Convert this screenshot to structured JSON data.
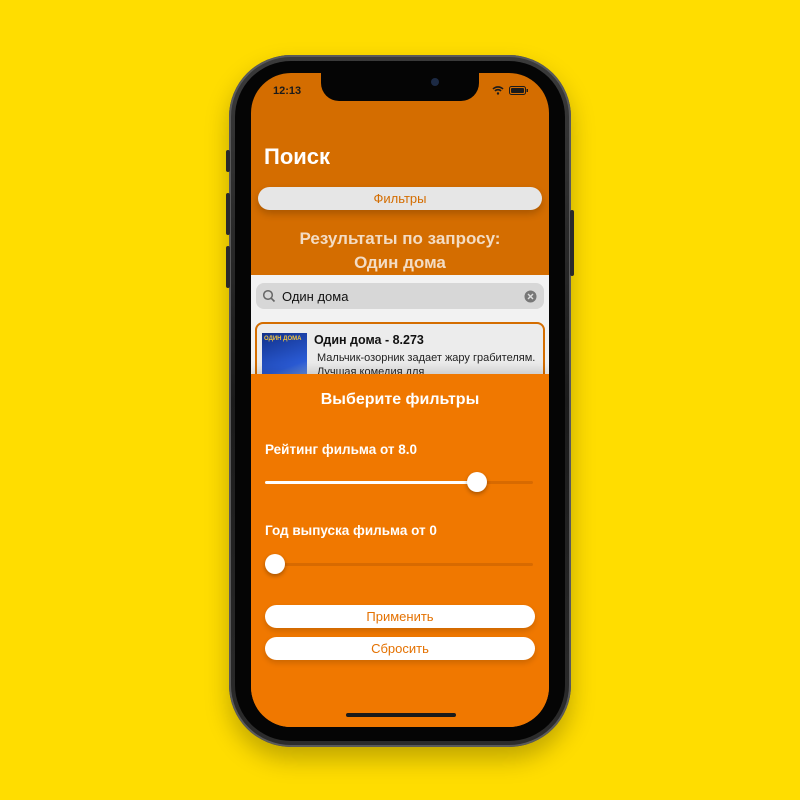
{
  "status_bar": {
    "time": "12:13",
    "wifi_icon": "wifi-icon",
    "battery_icon": "battery-icon"
  },
  "header": {
    "title": "Поиск"
  },
  "filters_button": {
    "label": "Фильтры"
  },
  "results": {
    "line1": "Результаты по запросу:",
    "line2": "Один дома"
  },
  "search": {
    "value": "Один дома",
    "search_icon": "magnifier-icon",
    "clear_icon": "clear-icon"
  },
  "movie": {
    "title": "Один дома - 8.273",
    "description": "Мальчик-озорник задает жару грабителям. Лучшая комедия для",
    "poster_text": "ОДИН ДОМА"
  },
  "filter_sheet": {
    "title": "Выберите фильтры",
    "rating": {
      "label": "Рейтинг фильма от 8.0",
      "level": 0.79
    },
    "year": {
      "label": "Год выпуска фильма от 0",
      "level": 0.0
    },
    "apply_label": "Применить",
    "reset_label": "Сбросить"
  },
  "colors": {
    "background": "#FFDD00",
    "accent": "#F07800",
    "header": "#D46D00"
  }
}
